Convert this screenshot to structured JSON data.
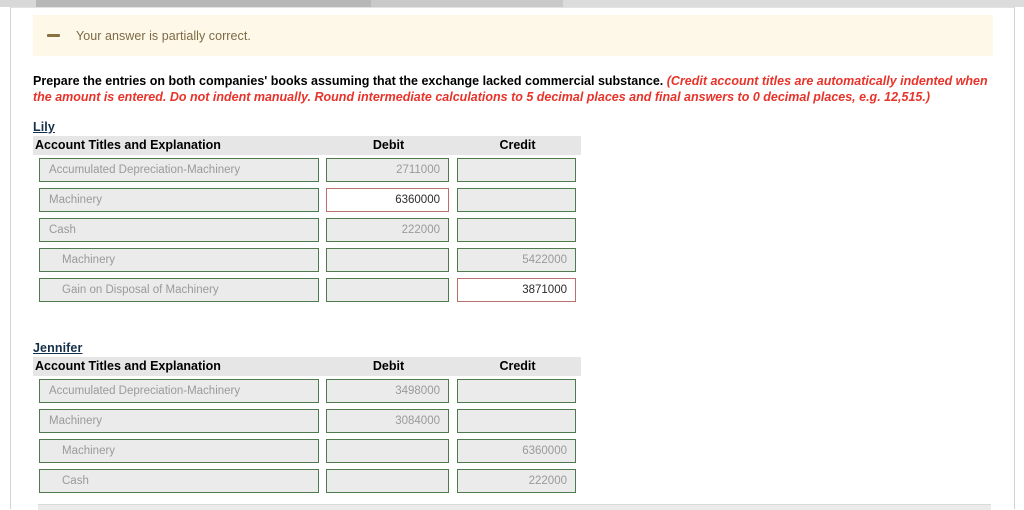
{
  "banner": {
    "icon": "minus-dash-icon",
    "text": "Your answer is partially correct.",
    "background_color": "#fdf8e8",
    "text_color": "#7d6a45"
  },
  "instruction": {
    "main": "Prepare the entries on both companies' books assuming that the exchange lacked commercial substance. ",
    "hint": "(Credit account titles are automatically indented when the amount is entered. Do not indent manually. Round intermediate calculations to 5 decimal places and final answers to 0 decimal places, e.g. 12,515.)",
    "hint_color": "#e8332a"
  },
  "table_headers": {
    "title": "Account Titles and Explanation",
    "debit": "Debit",
    "credit": "Credit"
  },
  "journals": [
    {
      "company": "Lily",
      "rows": [
        {
          "title": "Accumulated Depreciation-Machinery",
          "indented": false,
          "debit": "2711000",
          "credit": "",
          "title_state": "ok",
          "debit_state": "ok",
          "credit_state": "ok"
        },
        {
          "title": "Machinery",
          "indented": false,
          "debit": "6360000",
          "credit": "",
          "title_state": "ok",
          "debit_state": "wrong",
          "credit_state": "ok"
        },
        {
          "title": "Cash",
          "indented": false,
          "debit": "222000",
          "credit": "",
          "title_state": "ok",
          "debit_state": "ok",
          "credit_state": "ok"
        },
        {
          "title": "Machinery",
          "indented": true,
          "debit": "",
          "credit": "5422000",
          "title_state": "ok",
          "debit_state": "ok",
          "credit_state": "ok"
        },
        {
          "title": "Gain on Disposal of Machinery",
          "indented": true,
          "debit": "",
          "credit": "3871000",
          "title_state": "ok",
          "debit_state": "ok",
          "credit_state": "wrong"
        }
      ]
    },
    {
      "company": "Jennifer",
      "rows": [
        {
          "title": "Accumulated Depreciation-Machinery",
          "indented": false,
          "debit": "3498000",
          "credit": "",
          "title_state": "ok",
          "debit_state": "ok",
          "credit_state": "ok"
        },
        {
          "title": "Machinery",
          "indented": false,
          "debit": "3084000",
          "credit": "",
          "title_state": "ok",
          "debit_state": "ok",
          "credit_state": "ok"
        },
        {
          "title": "Machinery",
          "indented": true,
          "debit": "",
          "credit": "6360000",
          "title_state": "ok",
          "debit_state": "ok",
          "credit_state": "ok"
        },
        {
          "title": "Cash",
          "indented": true,
          "debit": "",
          "credit": "222000",
          "title_state": "ok",
          "debit_state": "ok",
          "credit_state": "ok"
        }
      ]
    }
  ],
  "colors": {
    "field_border_ok": "#4e7a4e",
    "field_border_wrong": "#b7706e",
    "field_fill": "#ebebeb",
    "header_fill": "#e6e6e6",
    "company_label": "#14304a"
  }
}
